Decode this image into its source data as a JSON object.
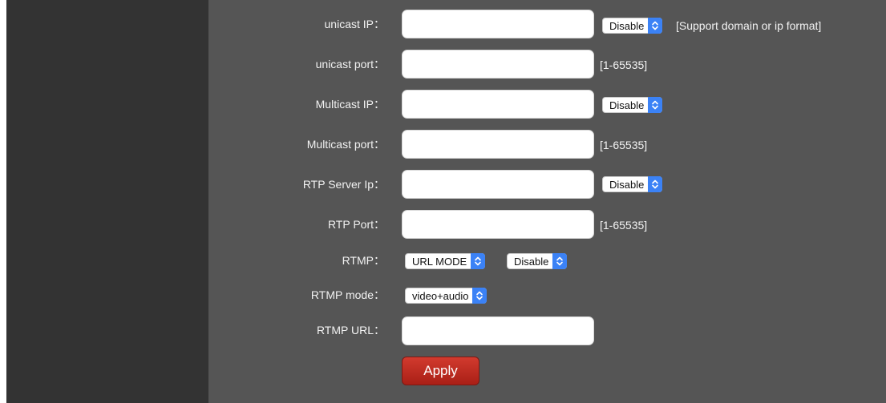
{
  "form": {
    "unicast_ip": {
      "label": "unicast IP：",
      "value": "",
      "select": "Disable",
      "hint": "[Support domain or ip format]"
    },
    "unicast_port": {
      "label": "unicast port：",
      "value": "",
      "hint": "[1-65535]"
    },
    "multicast_ip": {
      "label": "Multicast IP：",
      "value": "",
      "select": "Disable"
    },
    "multicast_port": {
      "label": "Multicast port：",
      "value": "",
      "hint": "[1-65535]"
    },
    "rtp_server_ip": {
      "label": "RTP Server Ip：",
      "value": "",
      "select": "Disable"
    },
    "rtp_port": {
      "label": "RTP Port：",
      "value": "",
      "hint": "[1-65535]"
    },
    "rtmp": {
      "label": "RTMP：",
      "mode_select": "URL MODE",
      "enable_select": "Disable"
    },
    "rtmp_mode": {
      "label": "RTMP mode：",
      "select": "video+audio"
    },
    "rtmp_url": {
      "label": "RTMP URL：",
      "value": ""
    },
    "apply_label": "Apply"
  },
  "icons": {
    "select_arrow": "up-down-chevron-icon"
  },
  "colors": {
    "panel_bg": "#555555",
    "sidebar_bg": "#333333",
    "select_accent": "#3b82f6",
    "apply_button": "#c0281d"
  }
}
